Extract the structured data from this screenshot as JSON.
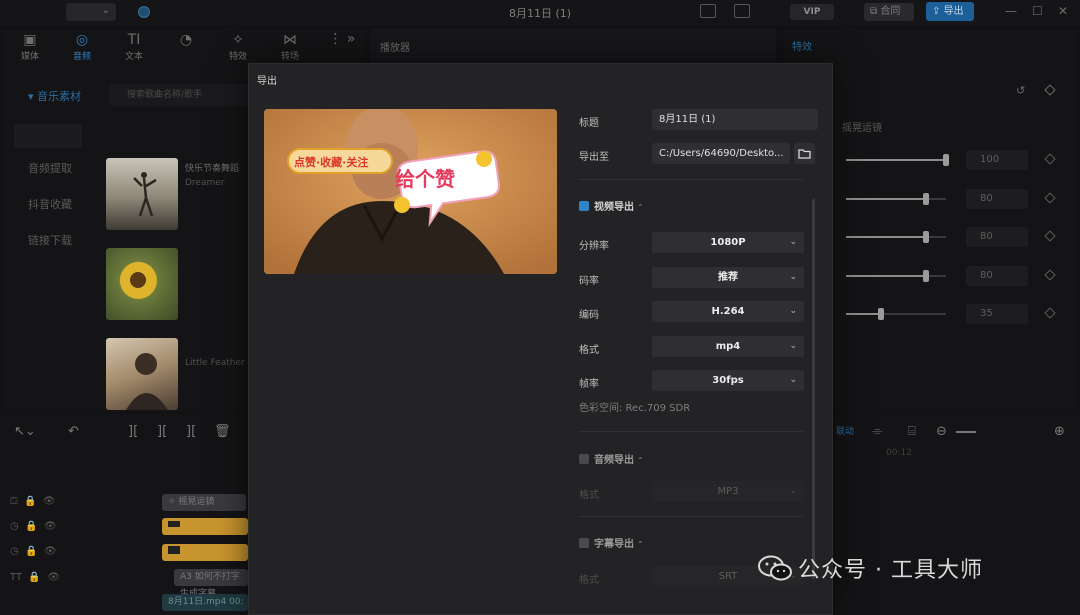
{
  "titlebar": {
    "title": "8月11日 (1)",
    "vip_badge": "VIP",
    "share_button": "合同",
    "export_button": "导出"
  },
  "left_panel": {
    "tabs": [
      {
        "icon": "media-icon",
        "label": "媒体"
      },
      {
        "icon": "audio-icon",
        "label": "音频"
      },
      {
        "icon": "text-icon",
        "label": "文本"
      },
      {
        "icon": "sticker-icon",
        "label": ""
      },
      {
        "icon": "effects-icon",
        "label": "特效"
      },
      {
        "icon": "transition-icon",
        "label": "转场"
      }
    ],
    "side_nav": [
      "音乐素材",
      "音频提取",
      "抖音收藏",
      "链接下载"
    ],
    "search_placeholder": "搜索歌曲名称/歌手",
    "items": [
      {
        "title": "快乐节奏舞蹈",
        "subtitle": "Dreamer"
      },
      {
        "title": "",
        "subtitle": ""
      },
      {
        "title": "",
        "subtitle": "Little Feather"
      }
    ]
  },
  "player": {
    "header": "播放器"
  },
  "right_panel": {
    "tab": "特效",
    "section_label": "摇晃运镜",
    "sliders": [
      {
        "value": "100",
        "level": 1.0
      },
      {
        "value": "80",
        "level": 0.8
      },
      {
        "value": "80",
        "level": 0.8
      },
      {
        "value": "80",
        "level": 0.8
      },
      {
        "value": "35",
        "level": 0.35
      }
    ]
  },
  "timeline": {
    "clips": [
      {
        "label": "摇晃运镜",
        "color": "#3a3a3e"
      },
      {
        "label": "",
        "color": "#c8942e"
      },
      {
        "label": "",
        "color": "#c8942e"
      },
      {
        "label": "",
        "color": "#c8942e"
      },
      {
        "label": "如何不打字生成字幕",
        "color": "#3a3a3e"
      }
    ],
    "main_clip": "8月11日.mp4",
    "main_clip_time": "00:"
  },
  "dialog": {
    "title": "导出",
    "preview": {
      "sticker_left": "点赞·收藏·关注",
      "sticker_right": "给个赞"
    },
    "fields": {
      "title_label": "标题",
      "title_value": "8月11日 (1)",
      "export_to_label": "导出至",
      "export_to_value": "C:/Users/64690/Deskto..."
    },
    "video_section": {
      "label": "视频导出",
      "checked": true,
      "rows": [
        {
          "label": "分辨率",
          "value": "1080P"
        },
        {
          "label": "码率",
          "value": "推荐"
        },
        {
          "label": "编码",
          "value": "H.264"
        },
        {
          "label": "格式",
          "value": "mp4"
        },
        {
          "label": "帧率",
          "value": "30fps"
        }
      ],
      "colorspace": "色彩空间:   Rec.709 SDR"
    },
    "audio_section": {
      "label": "音频导出",
      "checked": false,
      "row_label": "格式",
      "row_value": "MP3"
    },
    "subtitle_section": {
      "label": "字幕导出",
      "checked": false,
      "row_label": "格式",
      "row_value": "SRT"
    }
  },
  "watermark": {
    "text": "公众号 · 工具大师"
  },
  "colors": {
    "accent": "#2f85c9",
    "export_button": "#1d5f99",
    "dialog_bg": "#232325",
    "clip_yellow": "#c8942e"
  }
}
